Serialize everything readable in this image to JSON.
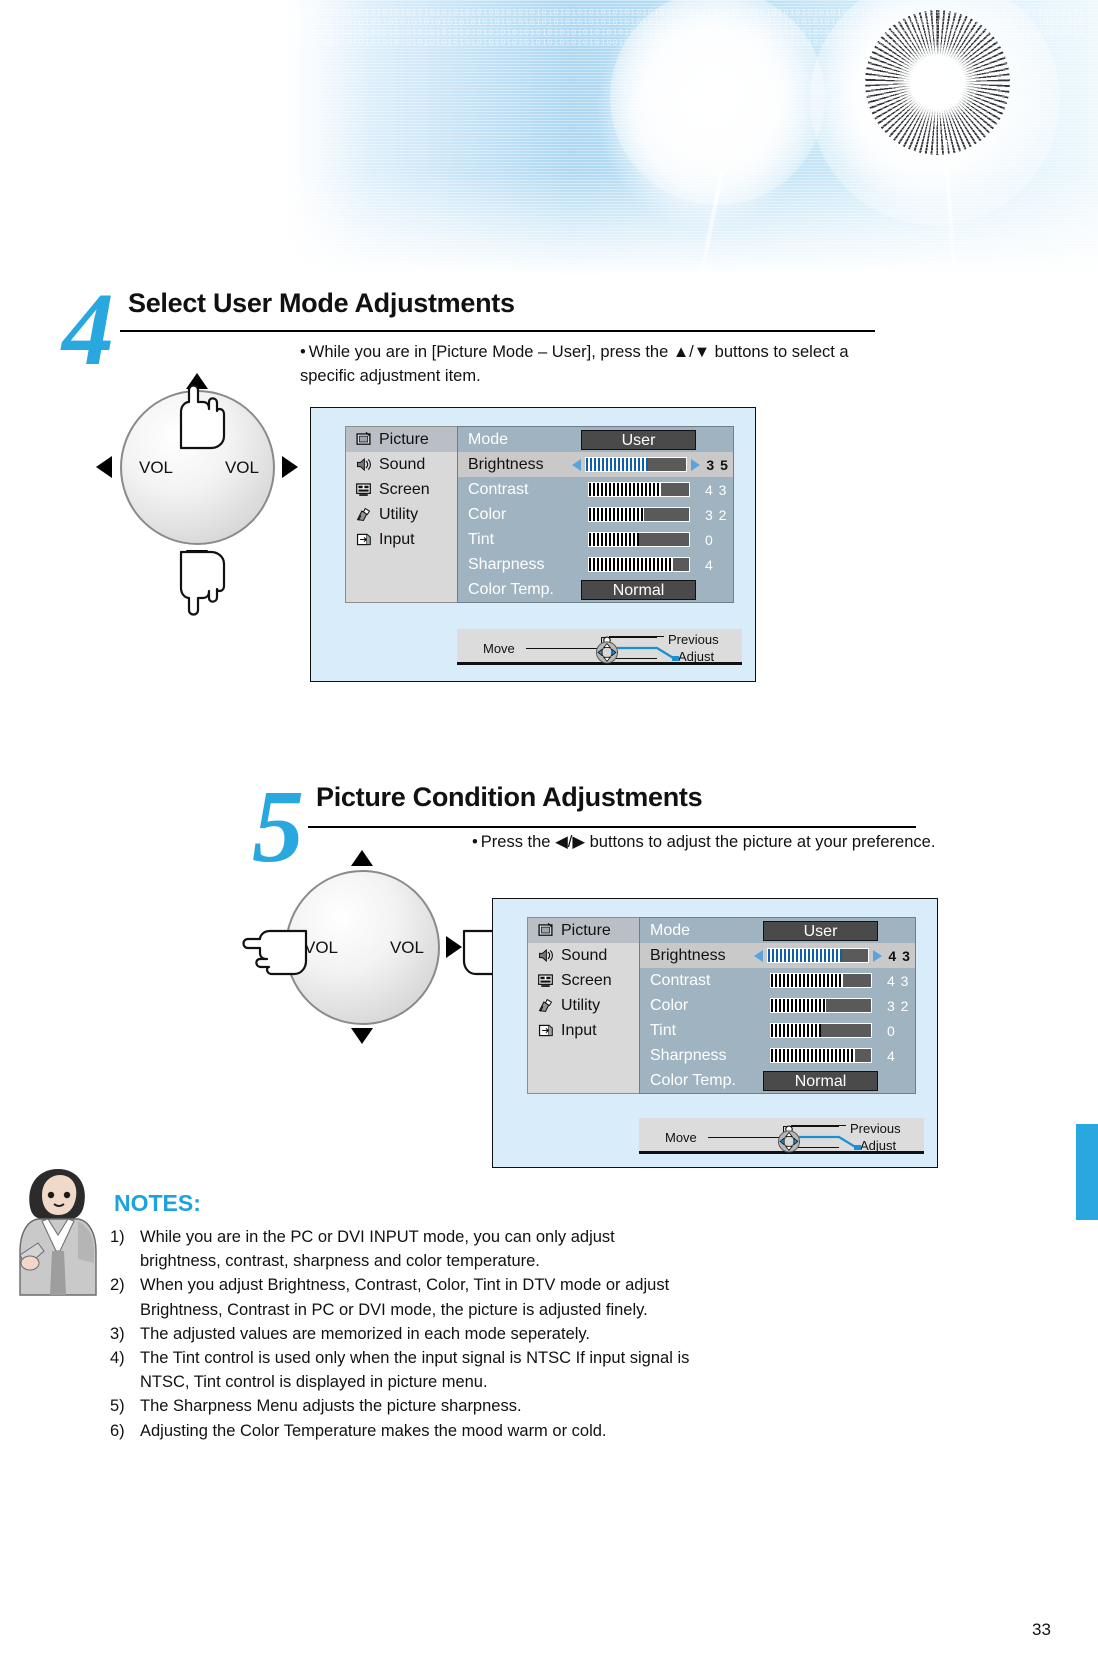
{
  "page": {
    "number": "33"
  },
  "banner": {
    "alt": "dandelion-binary-header",
    "bits": "01010101010101001010101010101010101010010101010101010101010101010101001010101010101010101010101010101010101010101010010101010101010101010101010101001010101011010101010101010101010101010101010101010101010101010101010101010101010101010101010101010100101010101010101010101010101010101010101010101010101010101010101010101010101010101010101010101010010101010101010101010101010101010101010101010101010101010101010101001010101010101010101010101010101010101010101010101010101010100101010101010101010101010101010101010101010101010101"
  },
  "steps": [
    {
      "number": "4",
      "title": "Select User Mode Adjustments",
      "bullet": "While you are in [Picture Mode – User], press the  ▲/▼  buttons to select  a specific adjustment item.",
      "wheel": {
        "left_label": "VOL",
        "right_label": "VOL",
        "hands": [
          "up",
          "down"
        ]
      }
    },
    {
      "number": "5",
      "title": "Picture Condition Adjustments",
      "bullet": "Press the ◀/▶ buttons to adjust the picture at your preference.",
      "wheel": {
        "left_label": "VOL",
        "right_label": "VOL",
        "hands": [
          "left",
          "right"
        ]
      }
    }
  ],
  "osd": {
    "sidebar": [
      {
        "label": "Picture",
        "icon": "picture-icon",
        "active": true
      },
      {
        "label": "Sound",
        "icon": "sound-icon",
        "active": false
      },
      {
        "label": "Screen",
        "icon": "screen-icon",
        "active": false
      },
      {
        "label": "Utility",
        "icon": "utility-icon",
        "active": false
      },
      {
        "label": "Input",
        "icon": "input-icon",
        "active": false
      }
    ],
    "navbar": {
      "move": "Move",
      "previous": "Previous",
      "adjust": "Adjust",
      "dpad_icon": "dpad-icon"
    },
    "menu_one": {
      "rows": [
        {
          "name": "Mode",
          "type": "chip",
          "value": "User",
          "selected": false
        },
        {
          "name": "Brightness",
          "type": "bar",
          "value": "3 5",
          "percent": 62,
          "selected": true
        },
        {
          "name": "Contrast",
          "type": "bar",
          "value": "4 3",
          "percent": 72,
          "selected": false
        },
        {
          "name": "Color",
          "type": "bar",
          "value": "3 2",
          "percent": 55,
          "selected": false
        },
        {
          "name": "Tint",
          "type": "bar",
          "value": "0",
          "percent": 50,
          "selected": false
        },
        {
          "name": "Sharpness",
          "type": "bar",
          "value": "4",
          "percent": 84,
          "selected": false
        },
        {
          "name": "Color Temp.",
          "type": "chip",
          "value": "Normal",
          "selected": false
        }
      ]
    },
    "menu_two": {
      "rows": [
        {
          "name": "Mode",
          "type": "chip",
          "value": "User",
          "selected": false
        },
        {
          "name": "Brightness",
          "type": "bar",
          "value": "4 3",
          "percent": 74,
          "selected": true
        },
        {
          "name": "Contrast",
          "type": "bar",
          "value": "4 3",
          "percent": 72,
          "selected": false
        },
        {
          "name": "Color",
          "type": "bar",
          "value": "3 2",
          "percent": 55,
          "selected": false
        },
        {
          "name": "Tint",
          "type": "bar",
          "value": "0",
          "percent": 50,
          "selected": false
        },
        {
          "name": "Sharpness",
          "type": "bar",
          "value": "4",
          "percent": 84,
          "selected": false
        },
        {
          "name": "Color Temp.",
          "type": "chip",
          "value": "Normal",
          "selected": false
        }
      ]
    }
  },
  "notes": {
    "title": "NOTES:",
    "items": [
      {
        "no": "1)",
        "text": "While you are in the PC or DVI INPUT mode, you can only adjust brightness, contrast, sharpness and color temperature."
      },
      {
        "no": "2)",
        "text": "When you adjust Brightness, Contrast, Color, Tint in DTV mode or adjust Brightness, Contrast in PC or DVI mode, the picture is adjusted finely."
      },
      {
        "no": "3)",
        "text": "The adjusted values are memorized in each mode seperately."
      },
      {
        "no": "4)",
        "text": "The Tint control is used only when the input signal is NTSC If input signal is NTSC, Tint control is displayed in picture menu."
      },
      {
        "no": "5)",
        "text": "The Sharpness Menu adjusts the picture sharpness."
      },
      {
        "no": "6)",
        "text": "Adjusting the Color Temperature makes the mood warm or cold."
      }
    ]
  },
  "colors": {
    "accent": "#29A8E0",
    "osd_bg": "#d8ecfa",
    "osd_body": "#9fb3c0",
    "osd_sidebar": "#d9d9d9",
    "chip": "#4a4a4a",
    "bar_selected": "#0f5fa8"
  }
}
